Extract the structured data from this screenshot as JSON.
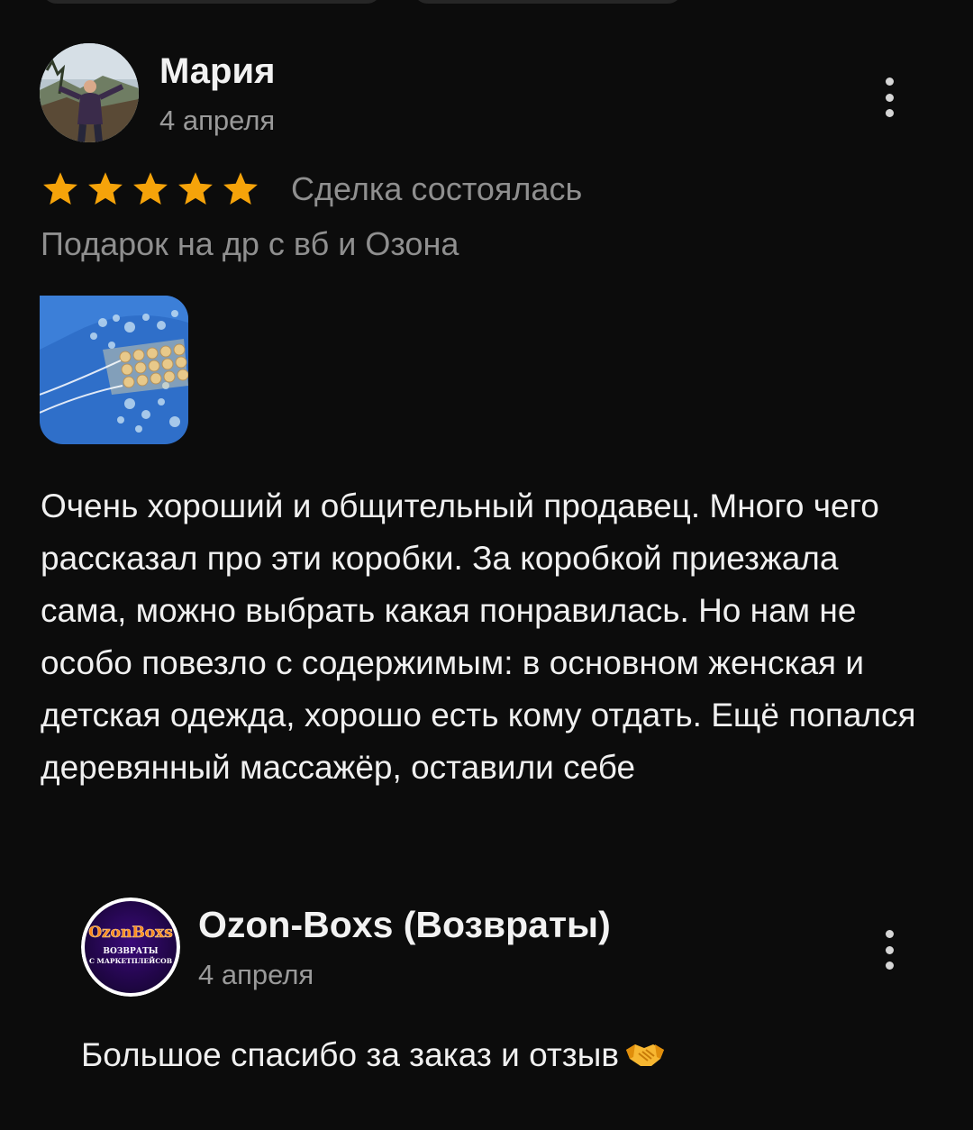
{
  "review": {
    "author": "Мария",
    "date": "4 апреля",
    "rating": 5,
    "status": "Сделка состоялась",
    "title": "Подарок на др с вб и Озона",
    "text": "Очень хороший и общительный продавец. Много чего рассказал про эти коробки. За коробкой приезжала сама, можно выбрать какая понравилась. Но нам не особо повезло с содержимым: в основном женская и детская одежда, хорошо есть кому отдать. Ещё попался деревянный массажёр, оставили себе",
    "photo_icon": "wooden-massager-photo"
  },
  "reply": {
    "author": "Ozon-Boxs (Возвраты)",
    "date": "4 апреля",
    "text": "Большое спасибо за заказ и отзыв",
    "emoji_icon": "handshake-icon",
    "avatar_logo": {
      "line1": "OzonBoxs",
      "line2": "ВОЗВРАТЫ",
      "line3": "С МАРКЕТПЛЕЙСОВ"
    }
  },
  "colors": {
    "background": "#0c0c0c",
    "star": "#f5a30a",
    "secondary_text": "#8f8f8f"
  }
}
